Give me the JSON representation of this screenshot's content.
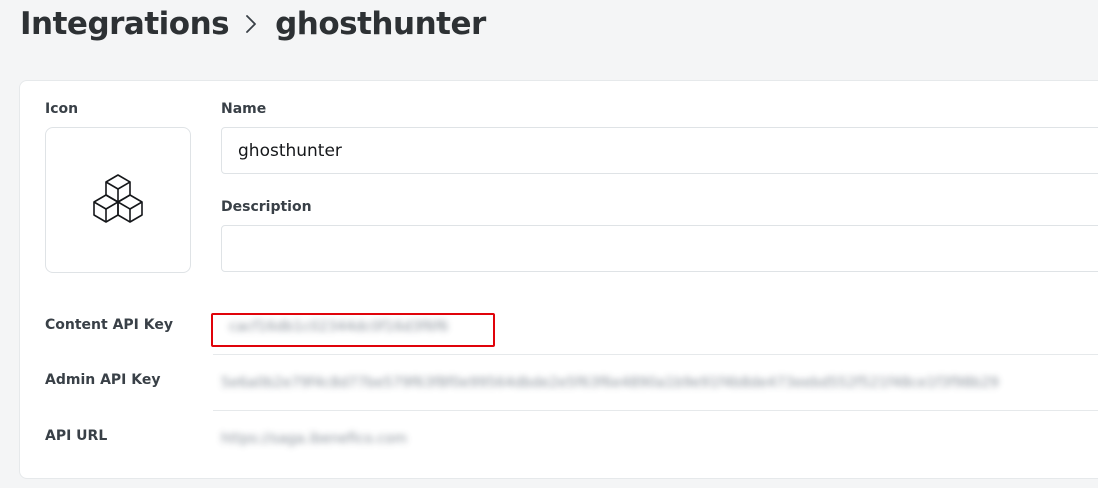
{
  "breadcrumb": {
    "parent": "Integrations",
    "current": "ghosthunter",
    "separator_icon": "chevron-right-icon"
  },
  "form": {
    "icon_label": "Icon",
    "icon_name": "cubes-icon",
    "name_label": "Name",
    "name_value": "ghosthunter",
    "description_label": "Description",
    "description_value": ""
  },
  "keys": {
    "content_label": "Content API Key",
    "content_value": "cacf16db1c02344dc0f16d3f6f6",
    "admin_label": "Admin API Key",
    "admin_value": "5e6a0b2e79f4c8d77be579f63f8f0e99564dbde2e5f63f6e4890a1b9e91f4b8de473eebd552f521f48ce1f3f98b29",
    "url_label": "API URL",
    "url_value": "https://saga.ibenefico.com"
  },
  "colors": {
    "highlight": "#e0030a",
    "accent": "#15171a"
  }
}
